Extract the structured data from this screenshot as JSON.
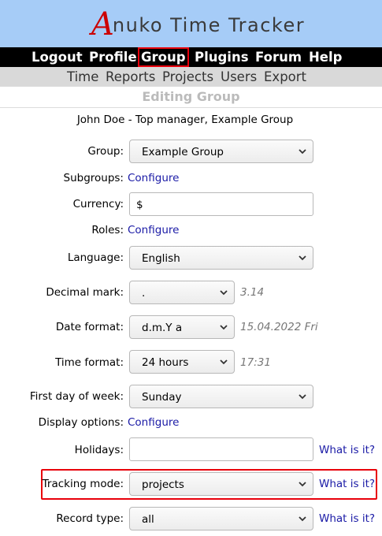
{
  "app": {
    "logo_initial": "A",
    "logo_rest": "nuko Time Tracker"
  },
  "top_nav": [
    "Logout",
    "Profile",
    "Group",
    "Plugins",
    "Forum",
    "Help"
  ],
  "sub_nav": [
    "Time",
    "Reports",
    "Projects",
    "Users",
    "Export"
  ],
  "page_title": "Editing Group",
  "user_line": "John Doe - Top manager, Example Group",
  "form": {
    "group": {
      "label": "Group:",
      "value": "Example Group"
    },
    "subgroups": {
      "label": "Subgroups:",
      "link": "Configure"
    },
    "currency": {
      "label": "Currency:",
      "value": "$"
    },
    "roles": {
      "label": "Roles:",
      "link": "Configure"
    },
    "language": {
      "label": "Language:",
      "value": "English"
    },
    "decimal_mark": {
      "label": "Decimal mark:",
      "value": ".",
      "example": "3.14"
    },
    "date_format": {
      "label": "Date format:",
      "value": "d.m.Y a",
      "example": "15.04.2022 Fri"
    },
    "time_format": {
      "label": "Time format:",
      "value": "24 hours",
      "example": "17:31"
    },
    "first_day": {
      "label": "First day of week:",
      "value": "Sunday"
    },
    "display_options": {
      "label": "Display options:",
      "link": "Configure"
    },
    "holidays": {
      "label": "Holidays:",
      "value": "",
      "help": "What is it?"
    },
    "tracking_mode": {
      "label": "Tracking mode:",
      "value": "projects",
      "help": "What is it?"
    },
    "record_type": {
      "label": "Record type:",
      "value": "all",
      "help": "What is it?"
    }
  },
  "colors": {
    "banner": "#a6ccf7",
    "nav": "#000000",
    "subnav": "#d9d9d9",
    "link": "#1a1aa6",
    "highlight": "#e8000b",
    "logo_accent": "#cc0000"
  },
  "icons": {
    "dropdown": "chevron-down-icon"
  }
}
